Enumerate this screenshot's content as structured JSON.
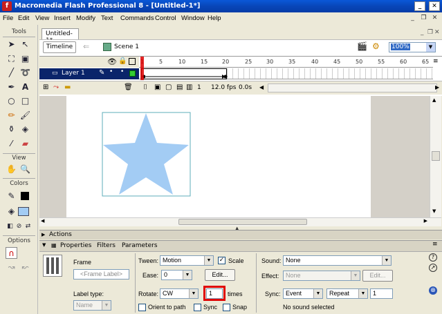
{
  "window": {
    "title": "Macromedia Flash Professional 8 - [Untitled-1*]",
    "app_icon": "f"
  },
  "menu": [
    "File",
    "Edit",
    "View",
    "Insert",
    "Modify",
    "Text",
    "Commands",
    "Control",
    "Window",
    "Help"
  ],
  "tools": {
    "header": "Tools",
    "view_header": "View",
    "colors_header": "Colors",
    "options_header": "Options"
  },
  "document": {
    "tab": "Untitled-1*",
    "timeline_button": "Timeline",
    "scene": "Scene 1",
    "zoom": "100%"
  },
  "timeline": {
    "layer_name": "Layer 1",
    "ruler_ticks": [
      "1",
      "5",
      "10",
      "15",
      "20",
      "25",
      "30",
      "35",
      "40",
      "45",
      "50",
      "55",
      "60",
      "65"
    ],
    "current_frame": "1",
    "fps": "12.0 fps",
    "elapsed": "0.0s"
  },
  "stage": {
    "shape": "star",
    "fill": "#A3CCF4",
    "box_stroke": "#5DADB8"
  },
  "panels": {
    "actions": "Actions",
    "tabs": [
      "Properties",
      "Filters",
      "Parameters"
    ]
  },
  "properties": {
    "frame_label": "Frame",
    "frame_placeholder": "<Frame Label>",
    "label_type_label": "Label type:",
    "label_type_value": "Name",
    "tween_label": "Tween:",
    "tween_value": "Motion",
    "scale_label": "Scale",
    "ease_label": "Ease:",
    "ease_value": "0",
    "edit_button": "Edit...",
    "rotate_label": "Rotate:",
    "rotate_value": "CW",
    "rotate_times_value": "1",
    "times_label": "times",
    "orient_label": "Orient to path",
    "sync_label": "Sync",
    "snap_label": "Snap",
    "sound_label": "Sound:",
    "sound_value": "None",
    "effect_label": "Effect:",
    "effect_value": "None",
    "effect_edit_button": "Edit...",
    "sync_sound_label": "Sync:",
    "sync_event_value": "Event",
    "sync_repeat_value": "Repeat",
    "sync_count_value": "1",
    "no_sound_status": "No sound selected"
  }
}
